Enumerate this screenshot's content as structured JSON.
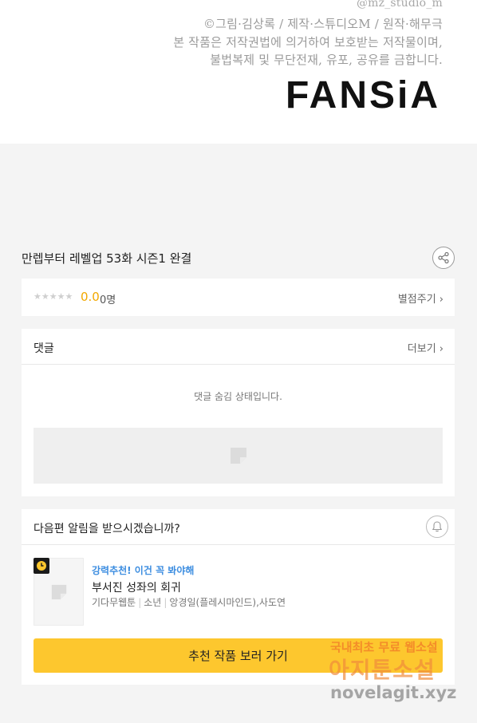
{
  "credit": {
    "handle": "@mz_studio_m",
    "line1": "©그림·김상록 / 제작·스튜디오M / 원작·해무극",
    "line2": "본 작품은 저작권법에 의거하여 보호받는 저작물이며,",
    "line3": "불법복제 및 무단전재, 유포, 공유를 금합니다.",
    "logo": "FANSiA"
  },
  "episode": {
    "title": "만렙부터 레벨업 53화 시즌1 완결"
  },
  "rating": {
    "stars": "★★★★★",
    "score": "0.0",
    "count": "0명",
    "rate_label": "별점주기 ›"
  },
  "comments": {
    "title": "댓글",
    "more_label": "더보기 ›",
    "hidden_message": "댓글 숨김 상태입니다."
  },
  "notify": {
    "question": "다음편 알림을 받으시겠습니까?"
  },
  "recommendation": {
    "tag": "강력추천! 이건 꼭 봐야해",
    "title": "부서진 성좌의 회귀",
    "meta": [
      "기다무웹툰",
      "소년",
      "앙경일(플레시마인드),사도연"
    ],
    "button_label": "추천 작품 보러 가기"
  },
  "watermark": {
    "line1": "국내최초 무료 웹소설",
    "line2": "아지툰소설",
    "line3": "novelagit.xyz"
  },
  "colors": {
    "accent_yellow": "#fdc72e",
    "score_orange": "#f2a800",
    "tag_blue": "#3c8de0"
  }
}
